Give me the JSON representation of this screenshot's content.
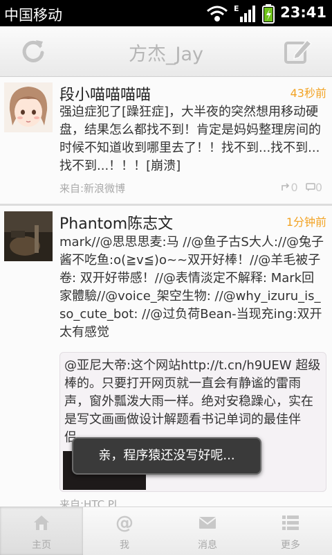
{
  "status_bar": {
    "carrier": "中国移动",
    "time": "23:41",
    "network": "E"
  },
  "title_bar": {
    "title": "方杰_Jay",
    "refresh_icon": "refresh-icon",
    "compose_icon": "compose-icon"
  },
  "posts": [
    {
      "name": "段小喵喵喵喵",
      "time": "43秒前",
      "text": "强迫症犯了[躁狂症]，大半夜的突然想用移动硬盘，结果怎么都找不到！肯定是妈妈整理房间的时候不知道收到哪里去了！！找不到...找不到...找不到...！！！[崩溃]",
      "source": "来自:新浪微博",
      "reposts": "0",
      "comments": "0"
    },
    {
      "name": "Phantom陈志文",
      "time": "1分钟前",
      "text": "mark//@思思思麦:马 //@鱼子古S大人://@兔子酱不吃鱼:o(≧v≦)o~~双开好棒！//@羊毛被子卷: 双开好带感！//@表情淡定不解释: Mark回家體驗//@voice_架空生物: //@why_izuru_is_so_cute_bot: //@过负荷Bean-当现充ing:双开太有感觉",
      "repost_text": "@亚尼大帝:这个网站http://t.cn/h9UEW 超级棒的。只要打开网页就一直会有静谧的雷雨声，窗外瓢泼大雨一样。绝对安稳躁心，实在是写文画画做设计解题看书记单词的最佳伴侣。",
      "source": "来自:HTC Pl"
    }
  ],
  "toast": "亲，程序猿还没写好呢...",
  "tabs": [
    {
      "label": "主页",
      "icon": "home-icon",
      "active": true
    },
    {
      "label": "我",
      "icon": "at-icon",
      "active": false
    },
    {
      "label": "消息",
      "icon": "mail-icon",
      "active": false
    },
    {
      "label": "更多",
      "icon": "list-icon",
      "active": false
    }
  ],
  "colors": {
    "time_accent": "#f2a324",
    "title_gray": "#b5b5b5"
  }
}
